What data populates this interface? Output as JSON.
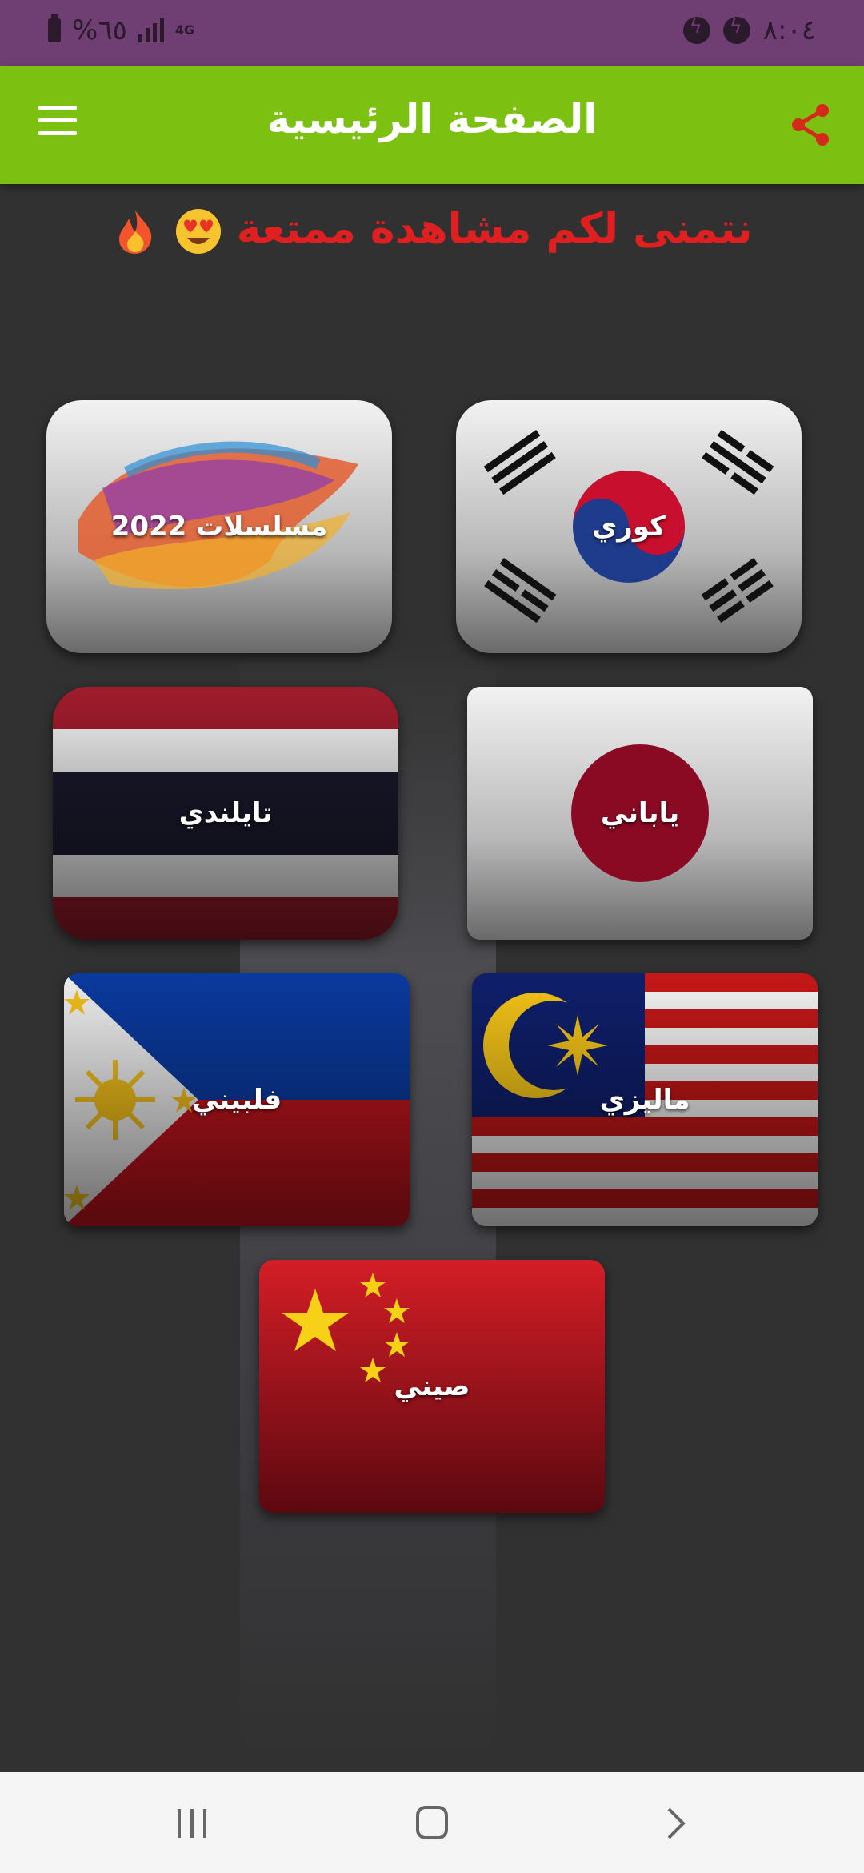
{
  "status_bar": {
    "battery": "%٦٥",
    "network": "4G",
    "time": "٨:٠٤",
    "icons": [
      "battery-icon",
      "signal-icon",
      "messenger-icon",
      "messenger-icon"
    ]
  },
  "app_bar": {
    "title": "الصفحة الرئيسية",
    "menu_icon": "menu-icon",
    "share_icon": "share-icon",
    "color": "#7cc111"
  },
  "greeting": {
    "text": "نتمنى لكم مشاهدة ممتعة",
    "emojis": [
      "heart-eyes-emoji",
      "fire-emoji"
    ],
    "color": "#e02020"
  },
  "categories": [
    {
      "label": "كوري",
      "flag": "south-korea"
    },
    {
      "label": "مسلسلات 2022",
      "flag": "2022"
    },
    {
      "label": "ياباني",
      "flag": "japan"
    },
    {
      "label": "تايلندي",
      "flag": "thailand"
    },
    {
      "label": "ماليزي",
      "flag": "malaysia"
    },
    {
      "label": "فلبيني",
      "flag": "philippines"
    },
    {
      "label": "صيني",
      "flag": "china"
    }
  ],
  "nav_bar": {
    "icons": [
      "recent-apps-icon",
      "home-icon",
      "back-icon"
    ]
  }
}
